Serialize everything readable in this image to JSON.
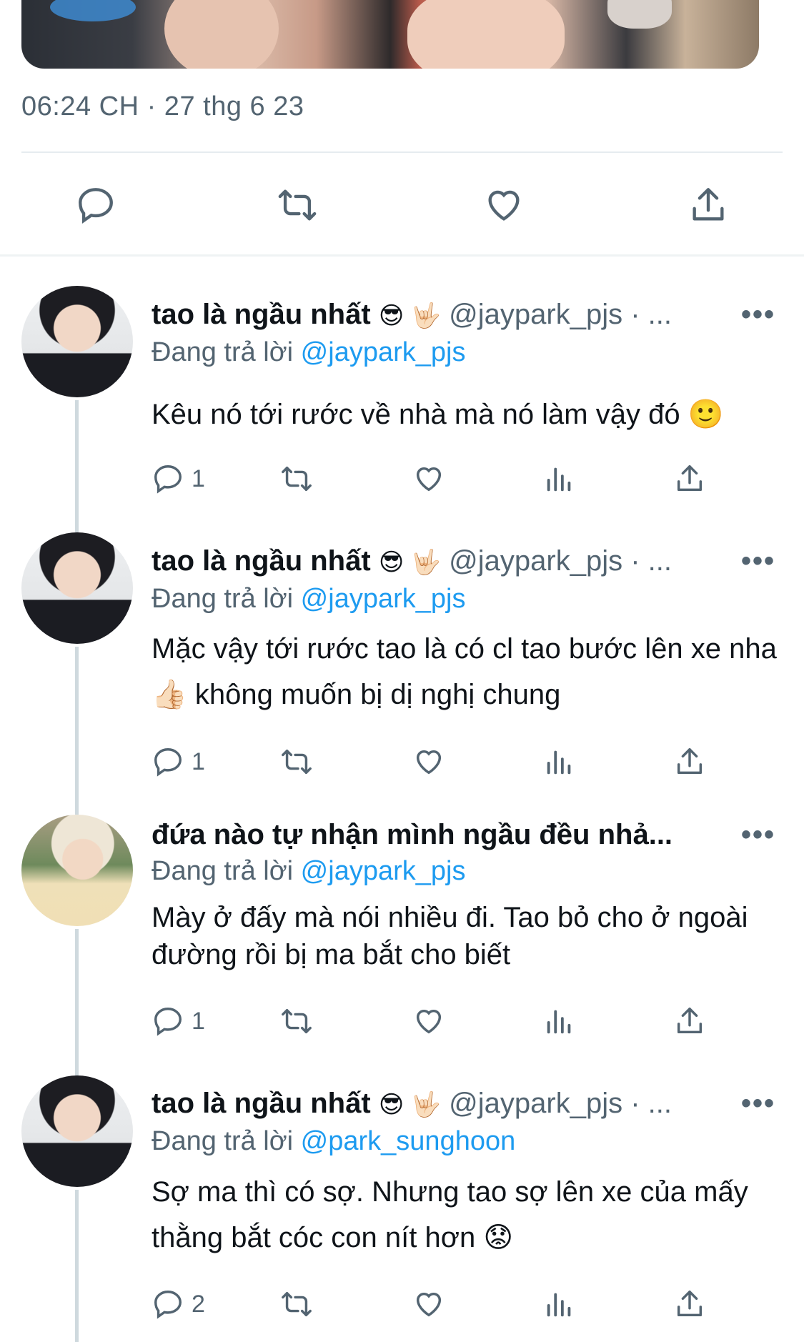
{
  "tweet": {
    "timestamp": "06:24 CH · 27 thg 6 23"
  },
  "icons": {
    "reply": "reply-bubble-icon",
    "retweet": "retweet-icon",
    "like": "heart-icon",
    "views": "views-bar-chart-icon",
    "share": "share-upload-icon",
    "more": "more-dots-icon"
  },
  "colors": {
    "accent": "#1d9bf0",
    "secondary_text": "#536471",
    "primary_text": "#0f1419"
  },
  "replies": [
    {
      "name": "tao là ngầu nhất",
      "emojis": "😎 🤟🏻",
      "handle": "@jaypark_pjs · ...",
      "replying_label": "Đang trả lời",
      "replying_to": "@jaypark_pjs",
      "text": "Kêu nó tới rước về nhà mà nó làm vậy đó 🙂",
      "reply_count": "1",
      "more": "•••"
    },
    {
      "name": "tao là ngầu nhất",
      "emojis": "😎 🤟🏻",
      "handle": "@jaypark_pjs · ...",
      "replying_label": "Đang trả lời",
      "replying_to": "@jaypark_pjs",
      "text": "Mặc vậy tới rước tao là có cl tao bước lên xe nha 👍🏻  không muốn bị dị nghị chung",
      "reply_count": "1",
      "more": "•••"
    },
    {
      "name": "đứa nào tự nhận mình ngầu đều nhả...",
      "emojis": "",
      "handle": "",
      "replying_label": "Đang trả lời",
      "replying_to": "@jaypark_pjs",
      "text": "Mày ở đấy mà nói nhiều đi. Tao bỏ cho ở ngoài đường rồi bị ma bắt cho biết",
      "reply_count": "1",
      "more": "•••"
    },
    {
      "name": "tao là ngầu nhất",
      "emojis": "😎 🤟🏻",
      "handle": "@jaypark_pjs · ...",
      "replying_label": "Đang trả lời",
      "replying_to": "@park_sunghoon",
      "text": "Sợ ma thì có sợ. Nhưng tao sợ lên xe của mấy thằng bắt cóc con nít hơn 😟",
      "reply_count": "2",
      "more": "•••"
    }
  ]
}
